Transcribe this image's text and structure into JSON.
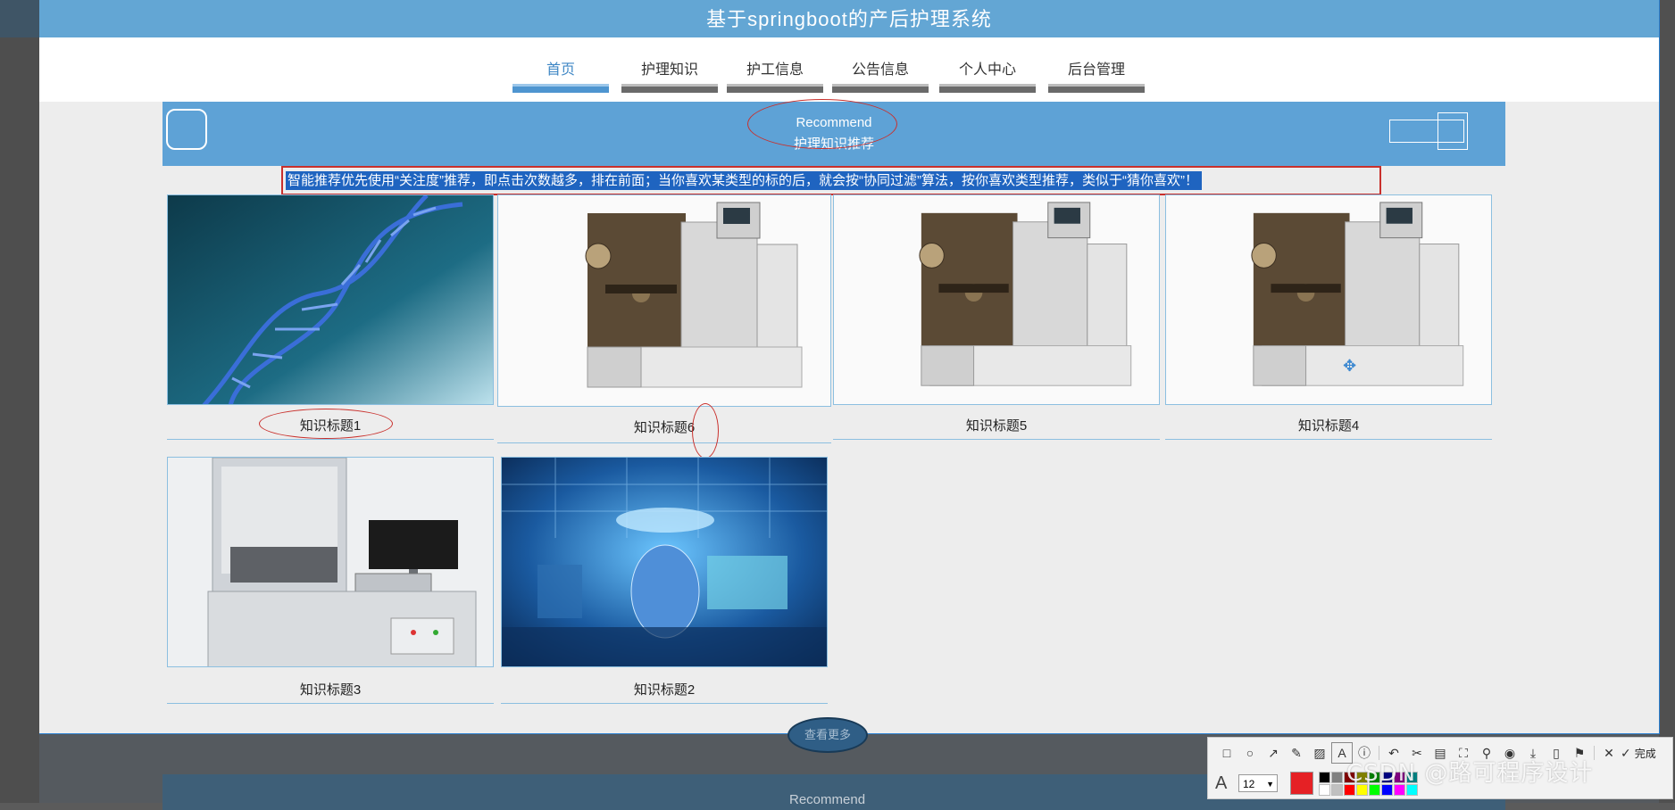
{
  "header": {
    "title": "基于springboot的产后护理系统"
  },
  "nav": {
    "items": [
      {
        "label": "首页",
        "active": true
      },
      {
        "label": "护理知识",
        "active": false
      },
      {
        "label": "护工信息",
        "active": false
      },
      {
        "label": "公告信息",
        "active": false
      },
      {
        "label": "个人中心",
        "active": false
      },
      {
        "label": "后台管理",
        "active": false
      }
    ]
  },
  "banner": {
    "title_en": "Recommend",
    "title_cn": "护理知识推荐"
  },
  "recommend_tip": "智能推荐优先使用“关注度”推荐，即点击次数越多，排在前面；当你喜欢某类型的标的后，就会按“协同过滤”算法，按你喜欢类型推荐，类似于“猜你喜欢”！",
  "cards": [
    {
      "title": "知识标题1",
      "image": "dna-helix"
    },
    {
      "title": "知识标题6",
      "image": "packaging-machine"
    },
    {
      "title": "知识标题5",
      "image": "packaging-machine"
    },
    {
      "title": "知识标题4",
      "image": "packaging-machine"
    },
    {
      "title": "知识标题3",
      "image": "test-station"
    },
    {
      "title": "知识标题2",
      "image": "exhibition-hall"
    }
  ],
  "more_button": "查看更多",
  "ghost_banner_text": "Recommend",
  "toolbar": {
    "done_label": "完成",
    "font_size": "12",
    "current_color": "#e52125",
    "palette": [
      "#000000",
      "#808080",
      "#800000",
      "#808000",
      "#008000",
      "#000080",
      "#800080",
      "#008080",
      "#ffffff",
      "#c0c0c0",
      "#ff0000",
      "#ffff00",
      "#00ff00",
      "#0000ff",
      "#ff00ff",
      "#00ffff"
    ]
  },
  "watermark": "CSDN @路可程序设计"
}
